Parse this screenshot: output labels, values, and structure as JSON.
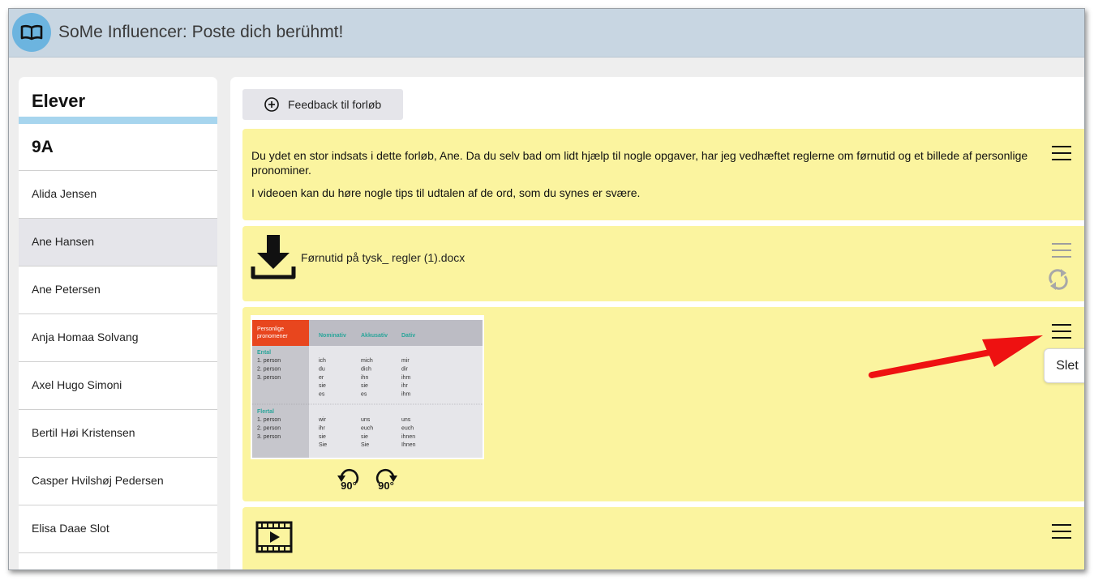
{
  "header": {
    "title": "SoMe Influencer: Poste dich berühmt!",
    "logo_icon": "open-book-icon"
  },
  "sidebar": {
    "title": "Elever",
    "class_name": "9A",
    "students": [
      {
        "name": "Alida Jensen",
        "selected": false
      },
      {
        "name": "Ane Hansen",
        "selected": true
      },
      {
        "name": "Ane Petersen",
        "selected": false
      },
      {
        "name": "Anja Homaa Solvang",
        "selected": false
      },
      {
        "name": "Axel Hugo Simoni",
        "selected": false
      },
      {
        "name": "Bertil Høi Kristensen",
        "selected": false
      },
      {
        "name": "Casper Hvilshøj Pedersen",
        "selected": false
      },
      {
        "name": "Elisa Daae Slot",
        "selected": false
      }
    ]
  },
  "main": {
    "feedback_button_label": "Feedback til forløb",
    "message": {
      "paragraph1": "Du ydet en stor indsats i dette forløb, Ane. Da du selv bad om lidt hjælp til nogle opgaver, har jeg vedhæftet reglerne om førnutid og et billede af personlige pronominer.",
      "paragraph2": "I videoen kan du høre nogle tips til udtalen af de ord, som du synes er svære."
    },
    "file": {
      "name": "Førnutid på tysk_ regler (1).docx"
    },
    "image_card": {
      "rotate_left_label": "90°",
      "rotate_right_label": "90°",
      "menu_tooltip": "Slet",
      "table": {
        "corner": [
          "Personlige",
          "pronomener"
        ],
        "columns": [
          "Nominativ",
          "Akkusativ",
          "Dativ"
        ],
        "groups": [
          {
            "label": "Ental",
            "persons": [
              "1. person",
              "2. person",
              "3. person"
            ],
            "nominativ": [
              "ich",
              "du",
              "er",
              "sie",
              "es"
            ],
            "akkusativ": [
              "mich",
              "dich",
              "ihn",
              "sie",
              "es"
            ],
            "dativ": [
              "mir",
              "dir",
              "ihm",
              "ihr",
              "ihm"
            ]
          },
          {
            "label": "Flertal",
            "persons": [
              "1. person",
              "2. person",
              "3. person"
            ],
            "nominativ": [
              "wir",
              "ihr",
              "sie",
              "Sie"
            ],
            "akkusativ": [
              "uns",
              "euch",
              "sie",
              "Sie"
            ],
            "dativ": [
              "uns",
              "euch",
              "ihnen",
              "Ihnen"
            ]
          }
        ]
      }
    }
  },
  "colors": {
    "header_bg": "#c8d6e2",
    "card_bg": "#fbf49f",
    "accent_blue": "#a7d5ee",
    "annotation_arrow": "#ee1111",
    "table_header_orange": "#e8461e",
    "table_header_teal": "#2aa59a"
  }
}
